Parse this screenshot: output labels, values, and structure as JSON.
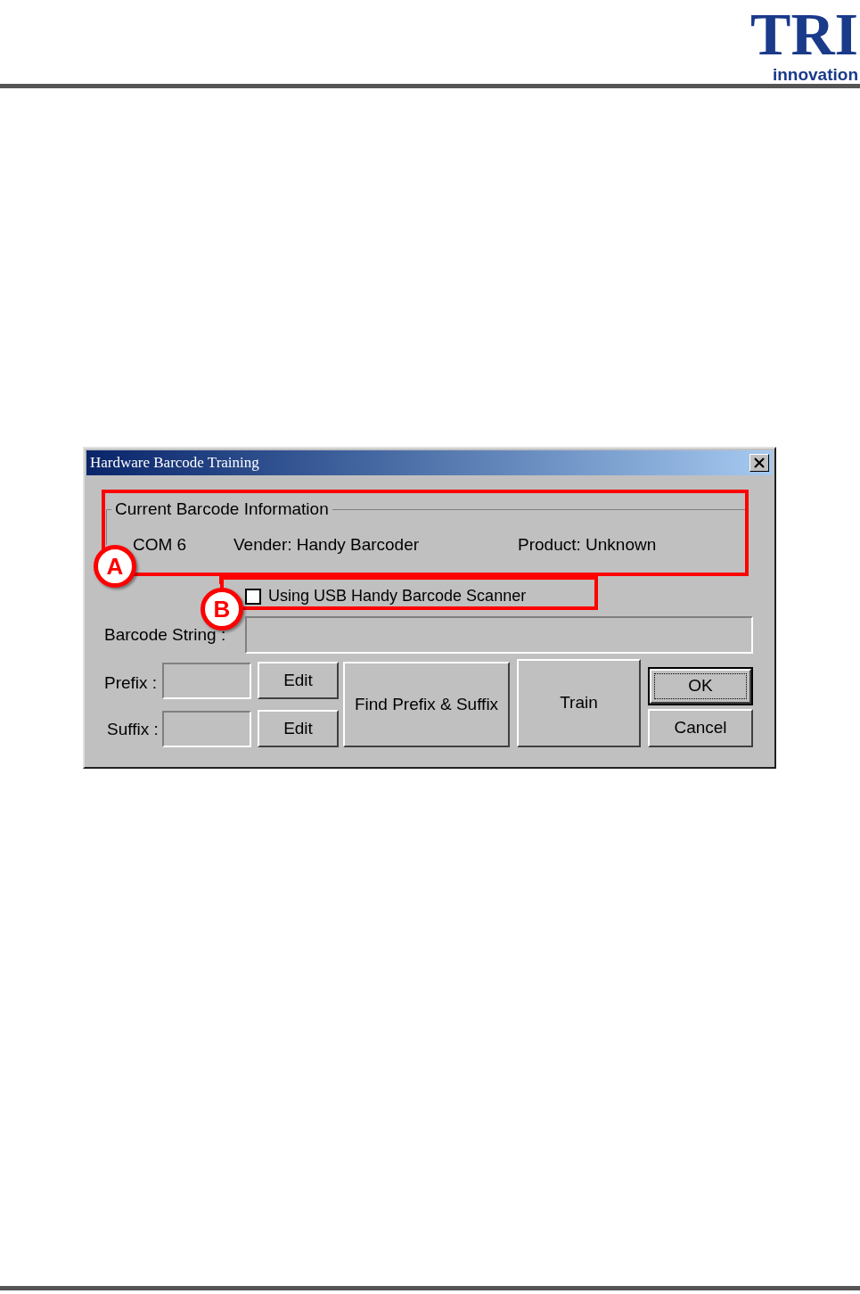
{
  "logo": {
    "mark": "TRI",
    "tagline": "innovation"
  },
  "dialog": {
    "title": "Hardware Barcode Training",
    "group": {
      "title": "Current Barcode Information",
      "items": [
        "COM 6",
        "Vender: Handy Barcoder",
        "Product: Unknown"
      ]
    },
    "usb_checkbox": {
      "label": "Using USB Handy Barcode Scanner",
      "checked": false
    },
    "barcode_string": {
      "label": "Barcode String :"
    },
    "prefix": {
      "label": "Prefix :",
      "button": "Edit"
    },
    "suffix": {
      "label": "Suffix :",
      "button": "Edit"
    },
    "find_button": "Find Prefix & Suffix",
    "train_button": "Train",
    "ok_button": "OK",
    "cancel_button": "Cancel"
  },
  "annotations": [
    {
      "label": "A"
    },
    {
      "label": "B"
    }
  ]
}
